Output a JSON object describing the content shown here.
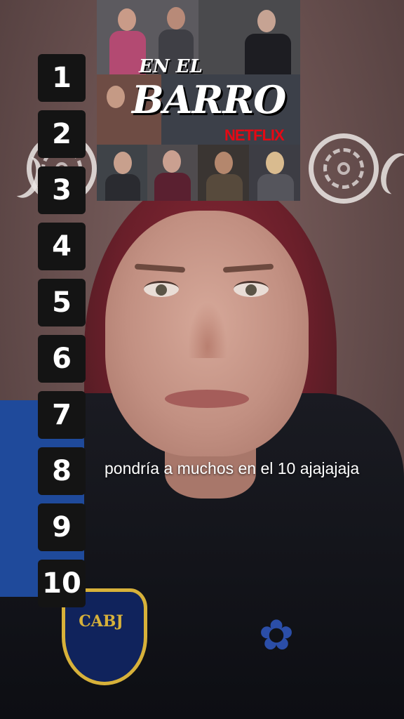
{
  "ranking": {
    "numbers": [
      "1",
      "2",
      "3",
      "4",
      "5",
      "6",
      "7",
      "8",
      "9",
      "10"
    ]
  },
  "poster": {
    "title_line1": "EN EL",
    "title_line2": "BARRO",
    "brand": "NETFLIX"
  },
  "caption": {
    "text": "pondría a muchos en el 10 ajajajaja"
  },
  "clothing": {
    "crest_text": "CABJ"
  },
  "colors": {
    "wall": "#6b5453",
    "badge_bg": "#141414",
    "netflix_red": "#e50914",
    "jersey_blue": "#1f4a9b",
    "crest_gold": "#d7b13a"
  }
}
